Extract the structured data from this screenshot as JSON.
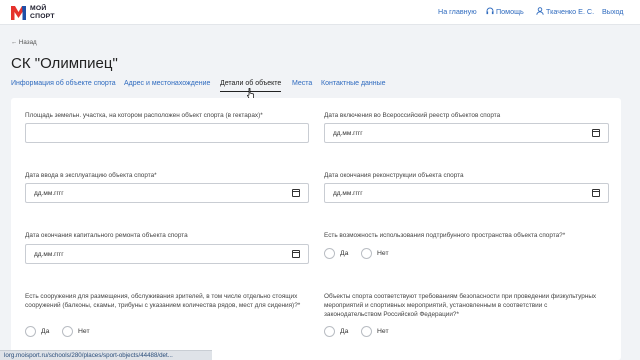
{
  "header": {
    "logo_line1": "МОЙ",
    "logo_line2": "СПОРТ",
    "nav_home": "На главную",
    "nav_help": "Помощь",
    "nav_user": "Ткаченко Е. С.",
    "nav_exit": "Выход"
  },
  "back_link": "← Назад",
  "page_title": "СК \"Олимпиец\"",
  "tabs": [
    {
      "label": "Информация об объекте спорта"
    },
    {
      "label": "Адрес и местонахождение"
    },
    {
      "label": "Детали об объекте"
    },
    {
      "label": "Места"
    },
    {
      "label": "Контактные данные"
    }
  ],
  "form": {
    "land_area_label": "Площадь земельн. участка, на котором расположен объект спорта (в гектарах)*",
    "land_area_value": "",
    "registry_date_label": "Дата включения во Всероссийский реестр объектов спорта",
    "commission_date_label": "Дата ввода в эксплуатацию объекта спорта*",
    "reconstruction_end_label": "Дата окончания реконструкции объекта спорта",
    "repair_end_label": "Дата окончания капитального ремонта объекта спорта",
    "under_stand_label": "Есть возможность использования подтрибунного пространства объекта спорта?*",
    "spectator_label": "Есть сооружения для размещения, обслуживания зрителей, в том числе отдельно стоящих сооружений (балконы, скамьи, трибуны с указанием количества рядов, мест для сидения)?*",
    "safety_label": "Объекты спорта соответствуют требованиям безопасности при проведении физкультурных мероприятий и спортивных мероприятий, установленным в соответствии с законодательством Российской Федерации?*",
    "date_placeholder": "дд.мм.гггг",
    "yes": "Да",
    "no": "Нет"
  },
  "status_url": "lorg.moisport.ru/schools/280/places/sport-objects/44488/det...",
  "colors": {
    "accent": "#2f6bbf",
    "logo_red": "#e5322d",
    "logo_blue": "#1d4fa8",
    "background": "#f1f3f6"
  }
}
